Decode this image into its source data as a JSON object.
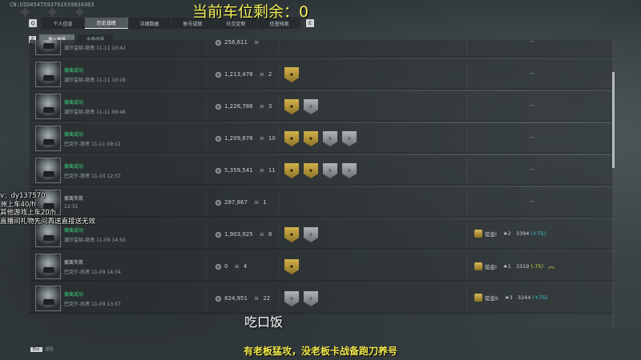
{
  "uid_text": "CN:UID4547593791939834383",
  "overlay_top": "当前车位剩余：0",
  "tabs": {
    "left_key": "Q",
    "right_key": "E",
    "items": [
      "个人信息",
      "历史战绩",
      "详细数据",
      "账号成就",
      "社交定制",
      "信誉档案"
    ],
    "active_index": 1
  },
  "subtabs": {
    "left_key": "Z",
    "items": [
      "烽火地带",
      "全面战场"
    ],
    "active_index": 0
  },
  "rows": [
    {
      "status": "",
      "status_class": "ok",
      "sub": "潮汐监狱-绝密 11-11 10:42",
      "money": "258,611",
      "kills": "",
      "badges": [],
      "rank": null,
      "dash": "--"
    },
    {
      "status": "撤离成功",
      "status_class": "ok",
      "sub": "潮汐监狱-绝密 11-11 10:19",
      "money": "1,213,478",
      "kills": "2",
      "badges": [
        "gold"
      ],
      "rank": null,
      "dash": "--"
    },
    {
      "status": "撤离成功",
      "status_class": "ok",
      "sub": "潮汐监狱-绝密 11-11 09:48",
      "money": "1,228,788",
      "kills": "3",
      "badges": [
        "gold",
        "silver"
      ],
      "rank": null,
      "dash": "--"
    },
    {
      "status": "撤离成功",
      "status_class": "ok",
      "sub": "巴克什-绝密 11-11 09:12",
      "money": "1,209,876",
      "kills": "10",
      "badges": [
        "gold",
        "gold",
        "silver",
        "silver"
      ],
      "rank": null,
      "dash": "--"
    },
    {
      "status": "撤离成功",
      "status_class": "ok",
      "sub": "巴克什-绝密 11-10 12:37",
      "money": "5,359,541",
      "kills": "11",
      "badges": [
        "gold",
        "gold",
        "silver",
        "silver"
      ],
      "rank": null,
      "dash": "--"
    },
    {
      "status": "撤离失败",
      "status_class": "fail",
      "sub": "12:31",
      "money": "287,867",
      "kills": "1",
      "badges": [],
      "rank": null,
      "dash": "--"
    },
    {
      "status": "撤离成功",
      "status_class": "ok",
      "sub": "潮汐监狱-绝密 11-09 14:50",
      "money": "1,903,925",
      "kills": "8",
      "badges": [
        "gold",
        "silver"
      ],
      "rank": {
        "tier": "铂金I",
        "stars": "2",
        "score": "3394",
        "delta": "(+75)",
        "delta_class": "cyan",
        "chevron": false
      },
      "dash": ""
    },
    {
      "status": "撤离失败",
      "status_class": "fail",
      "sub": "巴克什-机密 11-09 14:34",
      "money": "0",
      "kills": "4",
      "badges": [
        "gold"
      ],
      "rank": {
        "tier": "铂金I",
        "stars": "1",
        "score": "3319",
        "delta": "(-75)",
        "delta_class": "yellow",
        "chevron": true
      },
      "dash": ""
    },
    {
      "status": "撤离成功",
      "status_class": "ok",
      "sub": "巴克什-机密 11-09 13:57",
      "money": "824,951",
      "kills": "22",
      "badges": [
        "silver",
        "silver"
      ],
      "rank": {
        "tier": "铂金II",
        "stars": "3",
        "score": "3244",
        "delta": "(+75)",
        "delta_class": "cyan",
        "chevron": false
      },
      "dash": ""
    }
  ],
  "stream_info": [
    "v：dy137570",
    "洲上车40/h",
    "其他游戏上车20/h",
    "直播间礼物先问再送直接送无效"
  ],
  "caption": "吃口饭",
  "bottom_caption": "有老板猛攻，没老板卡战备跑刀养号",
  "footer": {
    "key": "Esc",
    "label": "返回"
  },
  "colors": {
    "success": "#36d77c",
    "accent_yellow": "#f4f05a",
    "gold_badge": "#d3b14c"
  }
}
